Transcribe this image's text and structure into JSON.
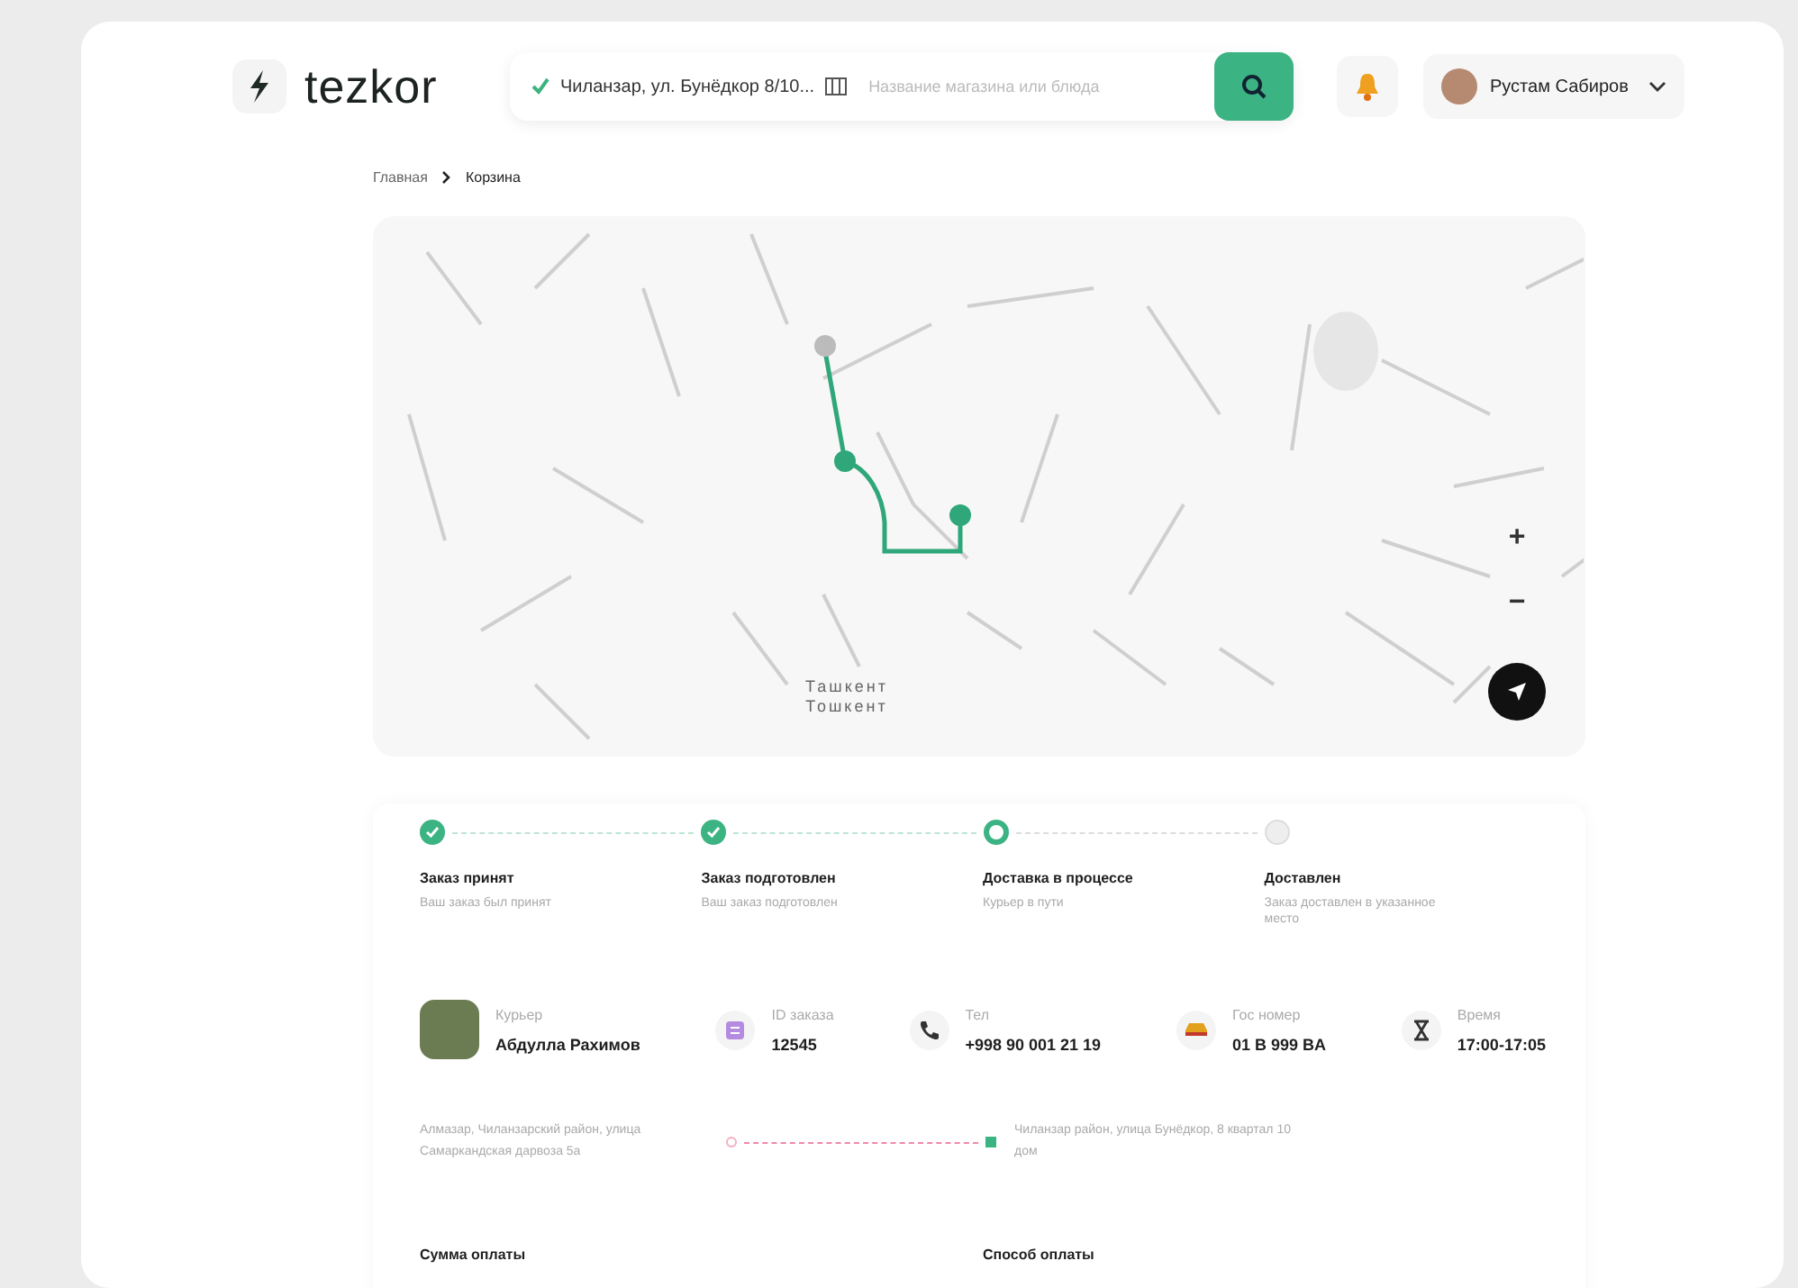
{
  "header": {
    "logo": "tezkor",
    "address": "Чиланзар, ул. Бунёдкор 8/10...",
    "search": {
      "placeholder": "Название магазина или блюда"
    },
    "user": "Рустам Сабиров"
  },
  "breadcrumbs": [
    {
      "label": "Главная"
    },
    {
      "label": "Корзина"
    }
  ],
  "map": {
    "labels": [
      "Ташкент",
      "Тошкент"
    ],
    "zoom_in": "+",
    "zoom_out": "−"
  },
  "steps": [
    {
      "title": "Заказ принят",
      "subtitle": "Ваш заказ был принят",
      "completed": true,
      "active": false
    },
    {
      "title": "Заказ подготовлен",
      "subtitle": "Ваш заказ подготовлен",
      "completed": true,
      "active": false
    },
    {
      "title": "Доставка в процессе",
      "subtitle": "Курьер в пути",
      "completed": false,
      "active": true
    },
    {
      "title": "Доставлен",
      "subtitle": "Заказ доставлен в указанное место",
      "completed": false,
      "active": false
    }
  ],
  "info": [
    {
      "kind": "avatar",
      "label": "Курьер",
      "value": "Абдулла Рахимов"
    },
    {
      "kind": "id",
      "label": "ID заказа",
      "value": "12545"
    },
    {
      "kind": "phone",
      "label": "Тел",
      "value": "+998 90 001 21 19"
    },
    {
      "kind": "car",
      "label": "Гос номер",
      "value": "01 B 999 BA"
    },
    {
      "kind": "time",
      "label": "Время",
      "value": "17:00-17:05"
    }
  ],
  "route": {
    "from": "Алмазар, Чиланзарский район, улица Самаркандская дарвоза 5а",
    "to": "Чиланзар район, улица Бунёдкор, 8 квартал 10 дом"
  },
  "payment": {
    "sum_label": "Сумма оплаты",
    "method_label": "Способ оплаты"
  }
}
